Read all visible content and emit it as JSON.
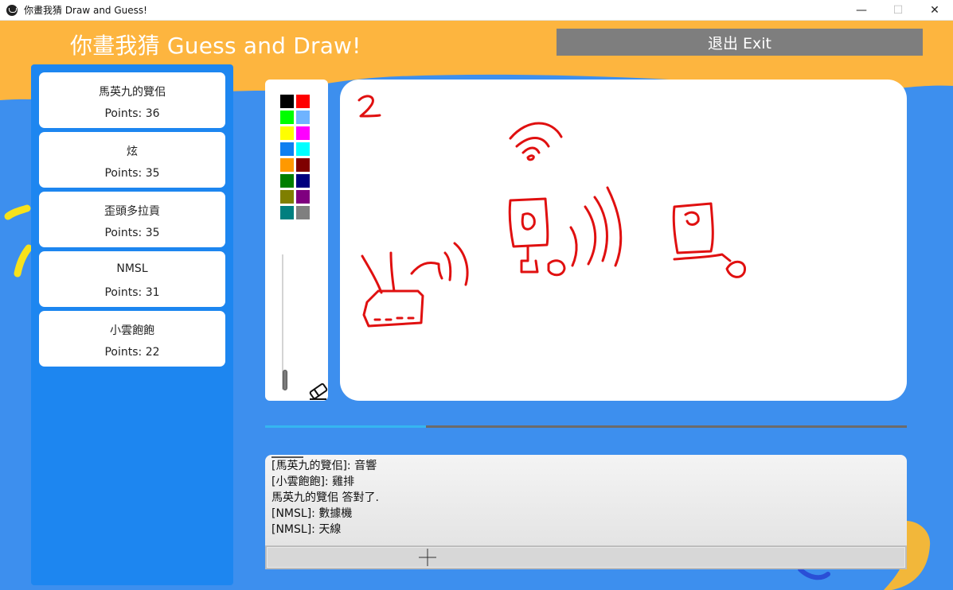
{
  "window": {
    "title": "你畫我猜 Draw and Guess!",
    "minimize_glyph": "—",
    "maximize_glyph": "☐",
    "close_glyph": "✕"
  },
  "header": {
    "title": "你畫我猜 Guess and Draw!",
    "exit_label": "退出 Exit"
  },
  "players": [
    {
      "name": "馬英九的覽佀",
      "points": "Points: 36"
    },
    {
      "name": "炫",
      "points": "Points: 35"
    },
    {
      "name": "歪頭多拉貢",
      "points": "Points: 35"
    },
    {
      "name": "NMSL",
      "points": "Points: 31"
    },
    {
      "name": "小雲飽飽",
      "points": "Points: 22"
    }
  ],
  "palette": {
    "colors": [
      "#000000",
      "#ff0000",
      "#00ff00",
      "#6fb3ff",
      "#ffff00",
      "#ff00ff",
      "#0f7ff0",
      "#00ffff",
      "#ff9900",
      "#7f0000",
      "#007f00",
      "#00007f",
      "#7f7f00",
      "#7f007f",
      "#007f7f",
      "#7f7f7f"
    ],
    "brush_size": 0.15,
    "eraser_icon": "eraser-icon"
  },
  "canvas": {
    "stroke_color": "#e01010"
  },
  "timer": {
    "progress": 0.25
  },
  "chat": {
    "messages": [
      "[馬英九的覽佀]: 音響",
      "[小雲飽飽]: 雞排",
      "馬英九的覽佀 答對了.",
      "[NMSL]: 數據機",
      "[NMSL]: 天線"
    ],
    "input_value": ""
  },
  "colors": {
    "orange": "#fdb53f",
    "blue": "#3d8fee",
    "panel_blue": "#1d86f0",
    "exit_gray": "#7e7e7e"
  }
}
